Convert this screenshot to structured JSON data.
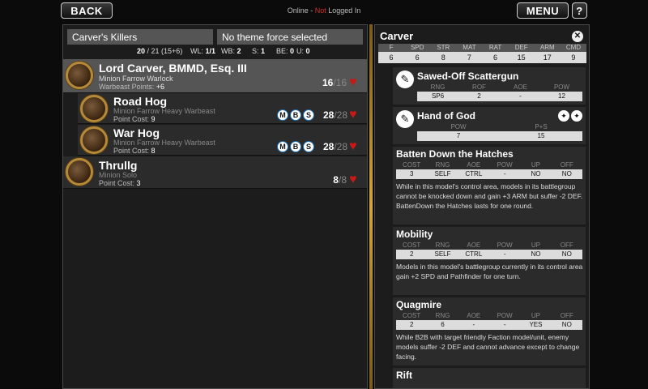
{
  "topbar": {
    "back_label": "BACK",
    "menu_label": "MENU",
    "help_label": "?",
    "status_online": "Online",
    "status_sep": " - ",
    "status_not": "Not",
    "status_logged": " Logged In"
  },
  "army": {
    "name": "Carver's Killers",
    "theme_force": "No theme force selected",
    "points": "20",
    "points_detail": "/ 21 (15+6)",
    "wl_label": "WL:",
    "wl_value": "1/1",
    "wb_label": "WB:",
    "wb_value": "2",
    "s_label": "S:",
    "s_value": "1",
    "be_label": "BE:",
    "be_value": "0",
    "u_label": "U:",
    "u_value": "0"
  },
  "units": [
    {
      "name": "Lord Carver, BMMD, Esq. III",
      "type": "Minion Farrow Warlock",
      "cost_label": "Warbeast Points:",
      "cost": "+6",
      "hp": "16",
      "hp_max": "/16",
      "badges": []
    },
    {
      "name": "Road Hog",
      "type": "Minion Farrow Heavy Warbeast",
      "cost_label": "Point Cost:",
      "cost": "9",
      "hp": "28",
      "hp_max": "/28",
      "badges": [
        "M",
        "B",
        "S"
      ]
    },
    {
      "name": "War Hog",
      "type": "Minion Farrow Heavy Warbeast",
      "cost_label": "Point Cost:",
      "cost": "8",
      "hp": "28",
      "hp_max": "/28",
      "badges": [
        "M",
        "B",
        "S"
      ]
    },
    {
      "name": "Thrullg",
      "type": "Minion Solo",
      "cost_label": "Point Cost:",
      "cost": "3",
      "hp": "8",
      "hp_max": "/8",
      "badges": []
    }
  ],
  "card": {
    "title": "Carver",
    "close_icon": "close-icon",
    "stat_headers": [
      "F",
      "SPD",
      "STR",
      "MAT",
      "RAT",
      "DEF",
      "ARM",
      "CMD"
    ],
    "stat_values": [
      "6",
      "6",
      "8",
      "7",
      "6",
      "15",
      "17",
      "9"
    ],
    "weapons": [
      {
        "name": "Sawed-Off Scattergun",
        "headers": [
          "RNG",
          "ROF",
          "AOE",
          "POW"
        ],
        "values": [
          "SP6",
          "2",
          "-",
          "12"
        ]
      },
      {
        "name": "Hand of God",
        "headers": [
          "POW",
          "P+S"
        ],
        "values": [
          "7",
          "15"
        ]
      }
    ],
    "spell_headers": [
      "COST",
      "RNG",
      "AOE",
      "POW",
      "UP",
      "OFF"
    ],
    "spells": [
      {
        "name": "Batten Down the Hatches",
        "values": [
          "3",
          "SELF",
          "CTRL",
          "-",
          "NO",
          "NO"
        ],
        "desc": "While in this model's control area, models in its battlegroup cannot be knocked down and gain +3 ARM but suffer -2 DEF. BattenDown the Hatches lasts for one round."
      },
      {
        "name": "Mobility",
        "values": [
          "2",
          "SELF",
          "CTRL",
          "-",
          "NO",
          "NO"
        ],
        "desc": "Models in this model's battlegroup currently in its control area gain +2 SPD and Pathfinder for one turn."
      },
      {
        "name": "Quagmire",
        "values": [
          "2",
          "6",
          "-",
          "-",
          "YES",
          "NO"
        ],
        "desc": "While B2B with target friendly Faction model/unit, enemy models suffer -2 DEF and cannot advance except to change facing."
      },
      {
        "name": "Rift",
        "values": [],
        "desc": ""
      }
    ]
  },
  "colors": {
    "accent_gold": "#d4a63c",
    "heart_red": "#c81818",
    "status_red": "#d03030"
  }
}
